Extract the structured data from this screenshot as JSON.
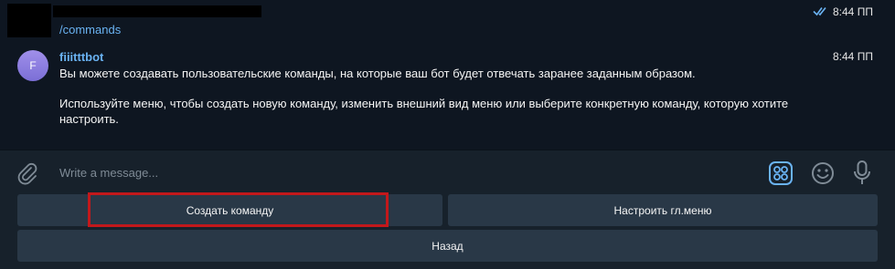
{
  "prev_message": {
    "text": "/commands",
    "time": "8:44 ПП"
  },
  "bot_message": {
    "avatar_letter": "F",
    "sender": "fiiitttbot",
    "time": "8:44 ПП",
    "paragraph1": "Вы можете создавать пользовательские команды, на которые ваш бот будет отвечать заранее заданным образом.",
    "paragraph2": "Используйте меню, чтобы создать новую команду, изменить внешний вид меню или выберите конкретную команду, которую хотите настроить."
  },
  "composer": {
    "placeholder": "Write a message...",
    "icons": [
      "paperclip-icon",
      "bot-commands-icon",
      "emoji-icon",
      "microphone-icon"
    ]
  },
  "keyboard": {
    "create_command": "Создать команду",
    "configure_menu": "Настроить гл.меню",
    "back": "Назад"
  },
  "colors": {
    "chat_bg": "#0e1621",
    "panel_bg": "#17212b",
    "button_bg": "#293847",
    "link": "#6ab3f3",
    "highlight": "#c2181b"
  }
}
